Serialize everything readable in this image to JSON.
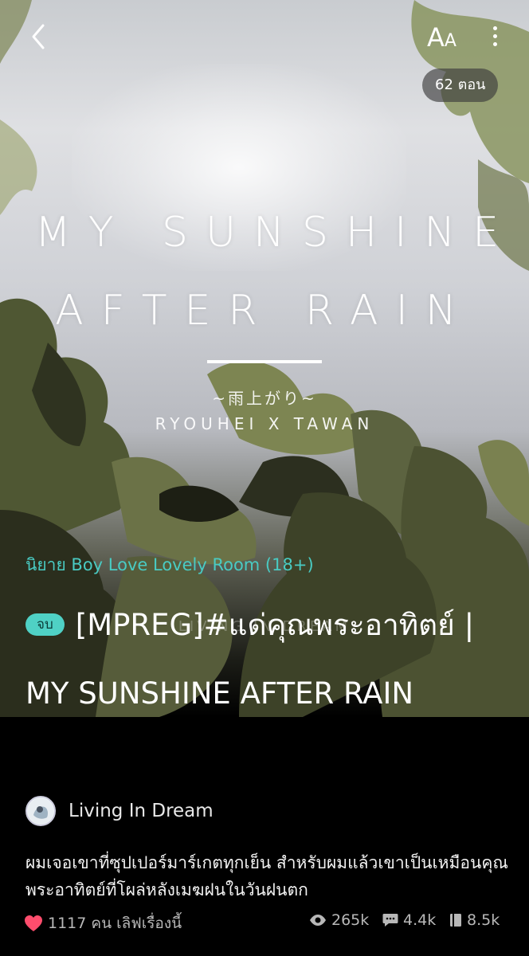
{
  "header": {
    "back_icon": "chevron-left-icon",
    "font_size_label_big": "A",
    "font_size_label_small": "A",
    "more_icon": "vertical-dots-icon",
    "episode_count": "62 ตอน"
  },
  "cover": {
    "title_line1": "MY SUNSHINE",
    "title_line2": "AFTER RAIN",
    "subtitle_jp": "~雨上がり~",
    "names": "RYOUHEI X TAWAN",
    "studio": "LIVING IN DREAM"
  },
  "novel": {
    "category": "นิยาย Boy Love Lovely Room (18+)",
    "status": "จบ",
    "title": "[MPREG]#แด่คุณพระอาทิตย์ | MY SUNSHINE AFTER RAIN",
    "author": "Living In Dream",
    "synopsis": "ผมเจอเขาที่ซุปเปอร์มาร์เกตทุกเย็น สำหรับผมแล้วเขาเป็นเหมือนคุณพระอาทิตย์ที่โผล่หลังเมฆฝนในวันฝนตก"
  },
  "stats": {
    "likes": "1117 คน เลิฟเรื่องนี้",
    "views": "265k",
    "comments": "4.4k",
    "bookmarks": "8.5k"
  },
  "colors": {
    "accent": "#4fd1c5",
    "category": "#49cbc3",
    "heart": "#ff4d6d",
    "muted": "#b8b8b8",
    "background": "#000000"
  }
}
